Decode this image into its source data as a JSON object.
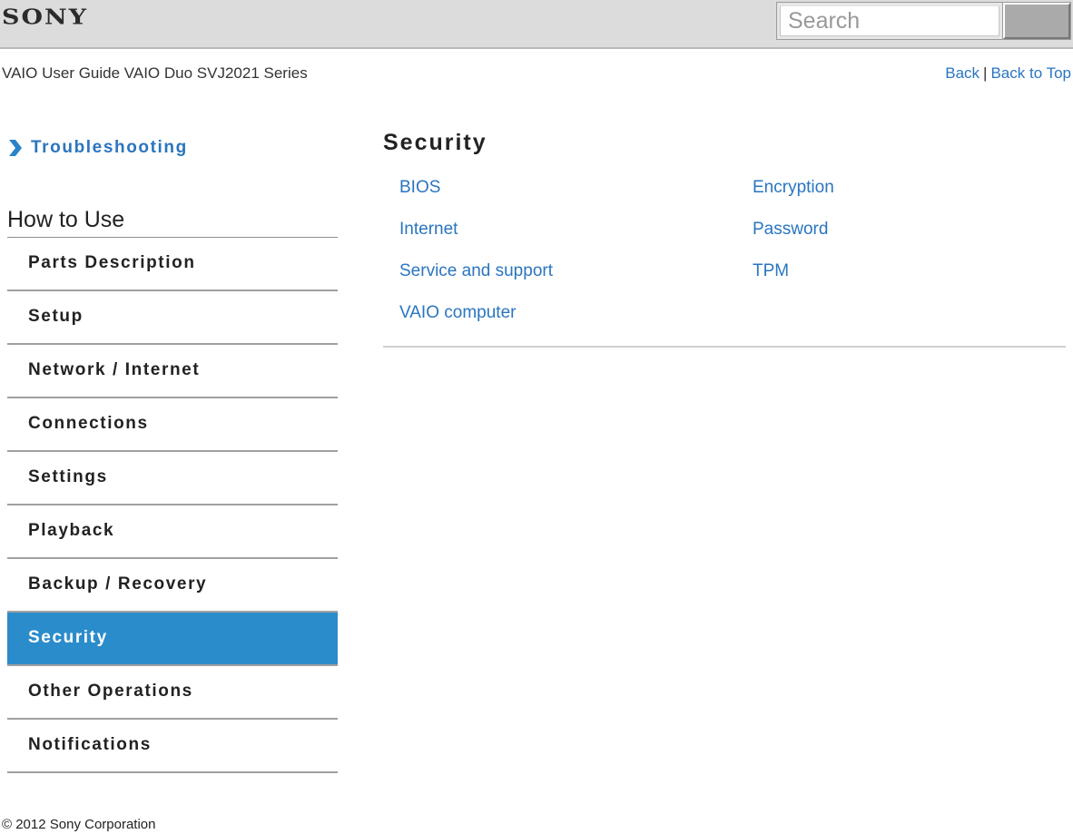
{
  "header": {
    "logo": "SONY",
    "search": {
      "placeholder": "Search",
      "value": "",
      "button_label": ""
    }
  },
  "subheader": {
    "title": "VAIO User Guide VAIO Duo SVJ2021 Series",
    "back_label": "Back",
    "separator": "|",
    "back_to_top_label": "Back to Top"
  },
  "sidebar": {
    "troubleshooting": {
      "icon": "chevron-right-icon",
      "label": "Troubleshooting"
    },
    "section_title": "How to Use",
    "items": [
      {
        "label": "Parts Description",
        "active": false
      },
      {
        "label": "Setup",
        "active": false
      },
      {
        "label": "Network / Internet",
        "active": false
      },
      {
        "label": "Connections",
        "active": false
      },
      {
        "label": "Settings",
        "active": false
      },
      {
        "label": "Playback",
        "active": false
      },
      {
        "label": "Backup / Recovery",
        "active": false
      },
      {
        "label": "Security",
        "active": true
      },
      {
        "label": "Other Operations",
        "active": false
      },
      {
        "label": "Notifications",
        "active": false
      }
    ]
  },
  "main": {
    "title": "Security",
    "links_col1": [
      "BIOS",
      "Internet",
      "Service and support",
      "VAIO computer"
    ],
    "links_col2": [
      "Encryption",
      "Password",
      "TPM"
    ]
  },
  "footer": {
    "copyright": "© 2012 Sony Corporation"
  },
  "colors": {
    "accent": "#2b8ccb",
    "link": "#2a75c0",
    "header_bg": "#dcdcdc"
  }
}
